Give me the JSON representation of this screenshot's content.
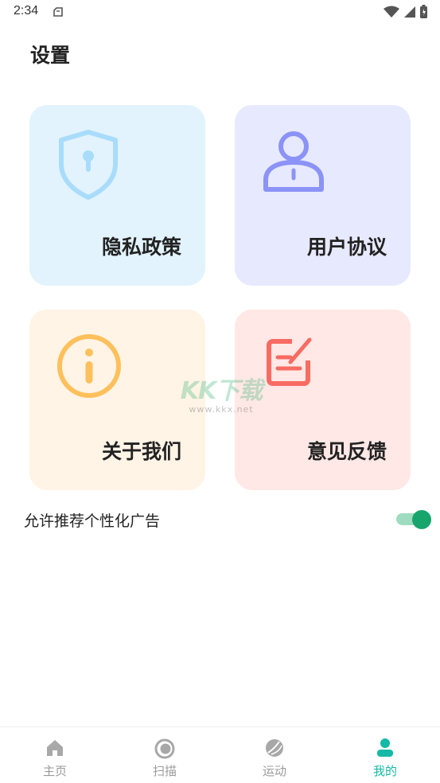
{
  "status_bar": {
    "time": "2:34"
  },
  "page": {
    "title": "设置"
  },
  "cards": [
    {
      "label": "隐私政策",
      "icon": "shield-icon",
      "color": "#e2f3fd",
      "icon_color": "#a9dcfb"
    },
    {
      "label": "用户协议",
      "icon": "user-icon",
      "color": "#e7e9fe",
      "icon_color": "#8b93f7"
    },
    {
      "label": "关于我们",
      "icon": "info-icon",
      "color": "#fff4e6",
      "icon_color": "#fec05c"
    },
    {
      "label": "意见反馈",
      "icon": "edit-icon",
      "color": "#ffe8e5",
      "icon_color": "#f86b62"
    }
  ],
  "ad_setting": {
    "label": "允许推荐个性化广告",
    "enabled": true,
    "accent": "#17a56d"
  },
  "watermark": {
    "main": "KK下载",
    "sub": "www.kkx.net"
  },
  "tabs": [
    {
      "label": "主页",
      "icon": "home-icon",
      "active": false
    },
    {
      "label": "扫描",
      "icon": "scan-icon",
      "active": false
    },
    {
      "label": "运动",
      "icon": "ball-icon",
      "active": false
    },
    {
      "label": "我的",
      "icon": "profile-icon",
      "active": true
    }
  ],
  "colors": {
    "active_tab": "#16b9a6",
    "inactive_tab": "#9a9a9a"
  }
}
